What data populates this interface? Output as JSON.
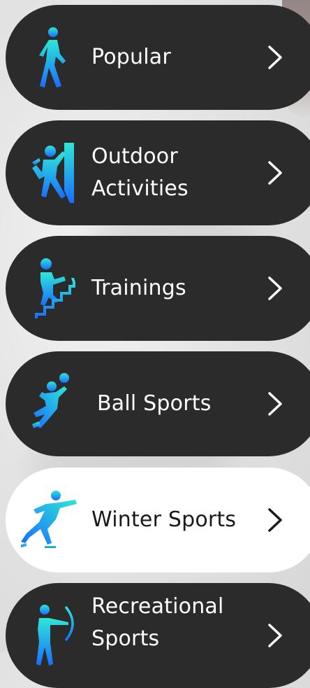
{
  "menu": {
    "items": [
      {
        "label": "Popular",
        "icon": "walking-person-icon",
        "style": "dark"
      },
      {
        "label": "Outdoor\nActivities",
        "icon": "climbing-icon",
        "style": "dark"
      },
      {
        "label": "Trainings",
        "icon": "stair-climbing-icon",
        "style": "dark"
      },
      {
        "label": "Ball Sports",
        "icon": "volleyball-icon",
        "style": "dark"
      },
      {
        "label": "Winter Sports",
        "icon": "skating-icon",
        "style": "light"
      },
      {
        "label": "Recreational\nSports",
        "icon": "archery-icon",
        "style": "dark"
      }
    ]
  },
  "colors": {
    "card_dark": "#2b2b2b",
    "card_light": "#ffffff",
    "icon_gradient_start": "#2ee6d6",
    "icon_gradient_end": "#1a6dff",
    "chevron_dark": "#ffffff",
    "chevron_light": "#1a1a1a"
  }
}
